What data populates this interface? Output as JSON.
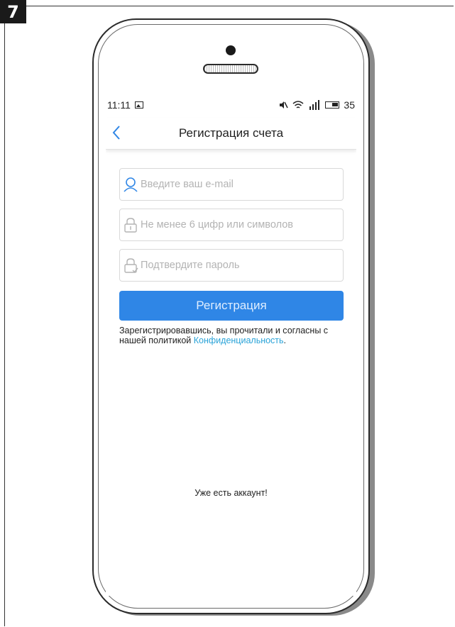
{
  "step": {
    "number": "7"
  },
  "status_bar": {
    "time": "11:11",
    "battery_level": "35",
    "icons": [
      "image-icon",
      "mute-icon",
      "wifi-icon",
      "signal-icon",
      "battery-icon"
    ]
  },
  "nav": {
    "title": "Регистрация счета",
    "back_icon": "chevron-left-icon"
  },
  "form": {
    "email": {
      "placeholder": "Введите ваш e-mail",
      "value": "",
      "icon": "user-icon"
    },
    "password": {
      "placeholder": "Не менее 6 цифр или символов",
      "value": "",
      "icon": "lock-icon"
    },
    "confirm": {
      "placeholder": "Подтвердите пароль",
      "value": "",
      "icon": "lock-check-icon"
    },
    "submit_label": "Регистрация"
  },
  "terms": {
    "text": "Зарегистрировавшись, вы прочитали и согласны с нашей политикой ",
    "link": "Конфиденциальность",
    "suffix": "."
  },
  "login_link": "Уже есть аккаунт!",
  "colors": {
    "accent": "#2f86e6",
    "link": "#2aa3d8",
    "back_icon": "#2f86e6"
  }
}
